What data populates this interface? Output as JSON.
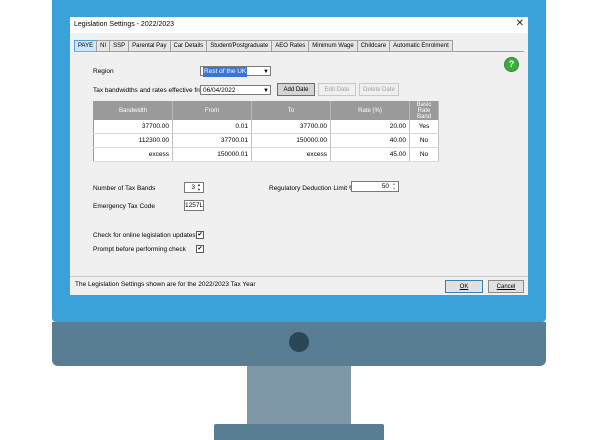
{
  "window": {
    "title": "Legislation Settings - 2022/2023"
  },
  "tabs": [
    {
      "label": "PAYE",
      "active": true
    },
    {
      "label": "NI"
    },
    {
      "label": "SSP"
    },
    {
      "label": "Parental Pay"
    },
    {
      "label": "Car Details"
    },
    {
      "label": "Student/Postgraduate"
    },
    {
      "label": "AEO Rates"
    },
    {
      "label": "Minimum Wage"
    },
    {
      "label": "Childcare"
    },
    {
      "label": "Automatic Enrolment"
    }
  ],
  "help_icon": "question-icon",
  "region": {
    "label": "Region",
    "value": "Rest of the UK"
  },
  "date": {
    "label": "Tax bandwidths and rates effective from",
    "value": "06/04/2022"
  },
  "buttons": {
    "add_date": "Add Date",
    "edit_date": "Edit Date",
    "delete_date": "Delete Date",
    "ok": "OK",
    "cancel": "Cancel"
  },
  "table": {
    "headers": [
      "Bandwidth",
      "From",
      "To",
      "Rate (%)",
      "Basic Rate Band"
    ],
    "rows": [
      [
        "37700.00",
        "0.01",
        "37700.00",
        "20.00",
        "Yes"
      ],
      [
        "112300.00",
        "37700.01",
        "150000.00",
        "40.00",
        "No"
      ],
      [
        "excess",
        "150000.01",
        "excess",
        "45.00",
        "No"
      ]
    ]
  },
  "tax_bands": {
    "label": "Number of Tax Bands",
    "value": "3"
  },
  "deduction_limit": {
    "label": "Regulatory Deduction Limit %",
    "value": "50"
  },
  "emergency_code": {
    "label": "Emergency Tax Code",
    "value": "1257L"
  },
  "checks": [
    {
      "label": "Check for online legislation updates",
      "checked": true
    },
    {
      "label": "Prompt before performing check",
      "checked": true
    }
  ],
  "status": "The Legislation Settings shown are for the 2022/2023 Tax Year",
  "colors": {
    "accent": "#3aa2d8",
    "monitor_chin": "#597d92",
    "help_green": "#3dab3d",
    "grid_header": "#9a9a9a"
  }
}
